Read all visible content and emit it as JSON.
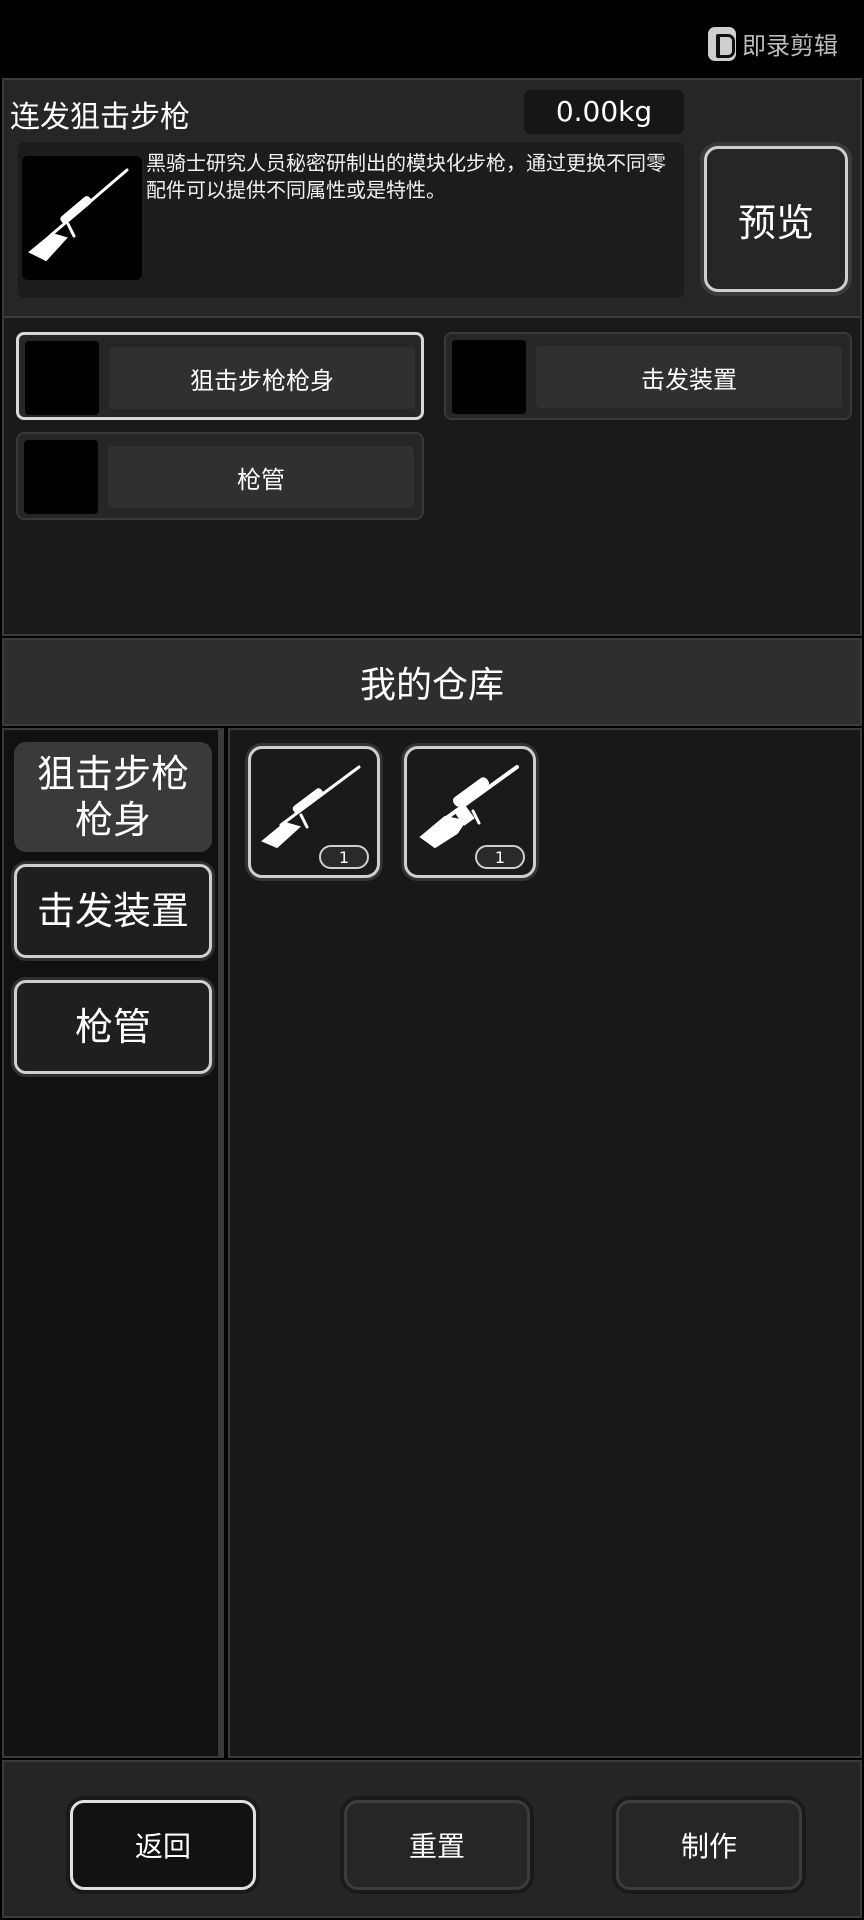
{
  "watermark": {
    "text": "即录剪辑",
    "icon": "app-logo-icon"
  },
  "item": {
    "name": "连发狙击步枪",
    "weight": "0.00kg",
    "description": "黑骑士研究人员秘密研制出的模块化步枪，通过更换不同零配件可以提供不同属性或是特性。",
    "icon": "sniper-rifle-icon"
  },
  "preview_label": "预览",
  "slots": [
    {
      "label": "狙击步枪枪身",
      "selected": true
    },
    {
      "label": "击发装置",
      "selected": false
    },
    {
      "label": "枪管",
      "selected": false
    }
  ],
  "warehouse": {
    "title": "我的仓库",
    "categories": [
      {
        "label": "狙击步枪\n枪身",
        "active": true
      },
      {
        "label": "击发装置",
        "active": false
      },
      {
        "label": "枪管",
        "active": false
      }
    ],
    "items": [
      {
        "icon": "sniper-rifle-icon",
        "count": "1"
      },
      {
        "icon": "scoped-rifle-icon",
        "count": "1"
      }
    ]
  },
  "footer": {
    "back": "返回",
    "reset": "重置",
    "craft": "制作"
  },
  "colors": {
    "background": "#000000",
    "panel": "#262626",
    "border_light": "#cfcfcf"
  }
}
